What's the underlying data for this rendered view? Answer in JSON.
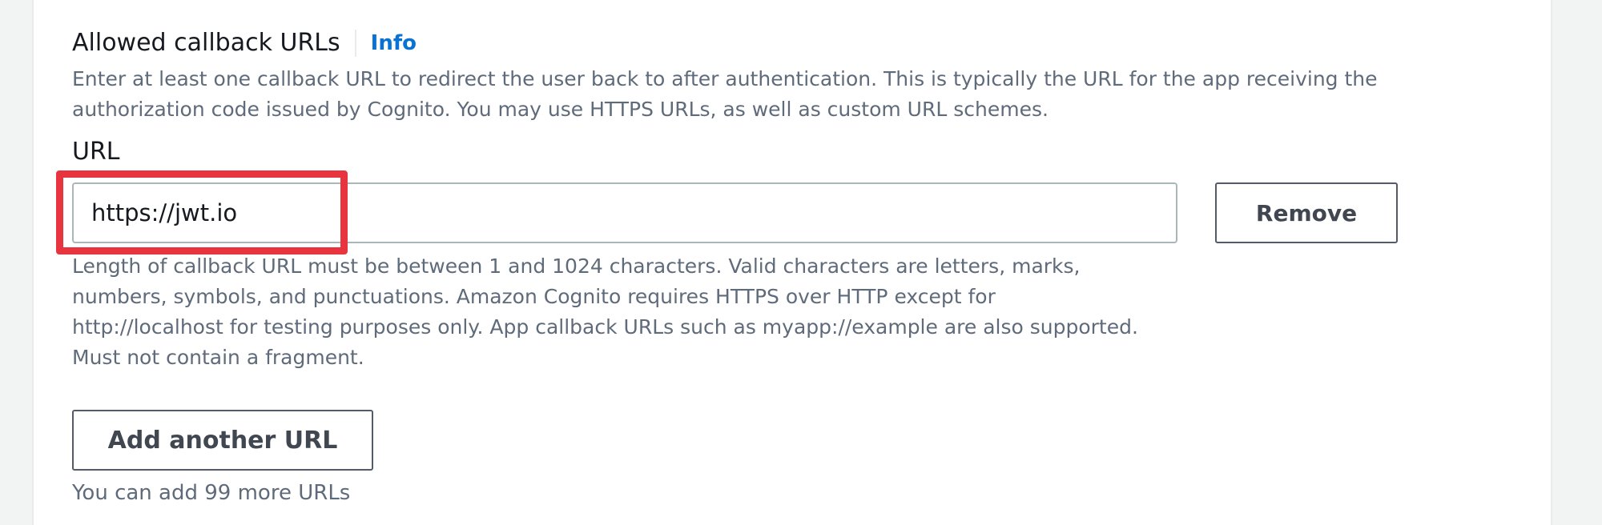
{
  "callback_urls": {
    "label": "Allowed callback URLs",
    "info_link": "Info",
    "description": "Enter at least one callback URL to redirect the user back to after authentication. This is typically the URL for the app receiving the authorization code issued by Cognito. You may use HTTPS URLs, as well as custom URL schemes.",
    "url_field": {
      "label": "URL",
      "value": "https://jwt.io",
      "remove_label": "Remove",
      "constraint_text": "Length of callback URL must be between 1 and 1024 characters. Valid characters are letters, marks, numbers, symbols, and punctuations. Amazon Cognito requires HTTPS over HTTP except for http://localhost for testing purposes only. App callback URLs such as myapp://example are also supported. Must not contain a fragment."
    },
    "add_button_label": "Add another URL",
    "remaining_text": "You can add 99 more URLs"
  },
  "colors": {
    "link": "#0972d3",
    "highlight": "#e8343f",
    "secondary_text": "#5f6b7a",
    "primary_text": "#16191f"
  }
}
